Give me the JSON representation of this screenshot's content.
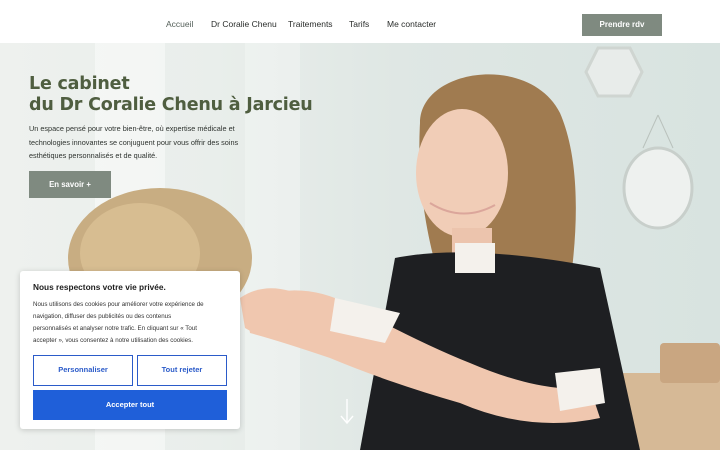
{
  "nav": {
    "items": [
      {
        "label": "Accueil",
        "active": true
      },
      {
        "label": "Dr Coralie Chenu"
      },
      {
        "label": "Traitements"
      },
      {
        "label": "Tarifs"
      },
      {
        "label": "Me contacter"
      }
    ],
    "cta_label": "Prendre rdv"
  },
  "hero": {
    "title_line1": "Le cabinet",
    "title_line2": "du Dr Coralie Chenu à Jarcieu",
    "description_line1": "Un espace pensé pour votre bien-être, où expertise médicale et",
    "description_line2": "technologies innovantes se conjuguent pour vous offrir des soins",
    "description_line3": "esthétiques personnalisés et de qualité.",
    "button_label": "En savoir +"
  },
  "cookie": {
    "title": "Nous respectons votre vie privée.",
    "text_line1": "Nous utilisons des cookies pour améliorer votre expérience de",
    "text_line2": "navigation, diffuser des publicités ou des contenus",
    "text_line3": "personnalisés et analyser notre trafic. En cliquant sur « Tout",
    "text_line4": "accepter », vous consentez à notre utilisation des cookies.",
    "customize_label": "Personnaliser",
    "reject_label": "Tout rejeter",
    "accept_label": "Accepter tout"
  },
  "icons": {
    "scroll": "arrow-down-icon"
  },
  "colors": {
    "brand_green": "#4f5e40",
    "button_sage": "#7f8a80",
    "accept_blue": "#1f5fd9",
    "outline_blue": "#2b5bc9"
  }
}
